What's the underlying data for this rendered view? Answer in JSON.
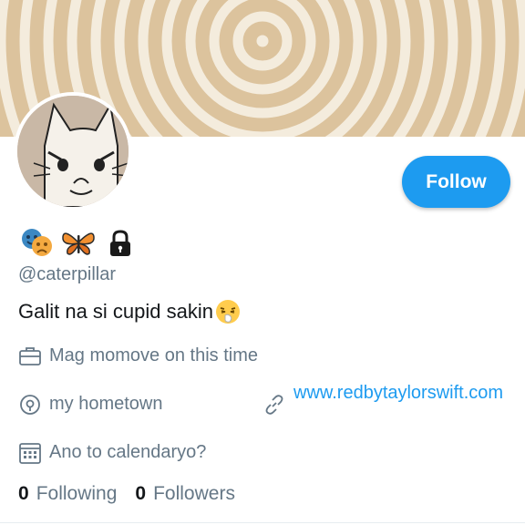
{
  "profile": {
    "handle": "@caterpillar",
    "bio": "Galit na si cupid sakin",
    "follow_label": "Follow",
    "badge_icons": [
      "performing-arts-icon",
      "butterfly-icon",
      "lock-icon"
    ],
    "bio_emoji": "sneezing-face-icon"
  },
  "meta": {
    "work": "Mag momove on this time",
    "location": "my hometown",
    "website": "www.redbytaylorswift.com",
    "joined": "Ano to calendaryo?"
  },
  "stats": {
    "following_count": "0",
    "following_label": "Following",
    "followers_count": "0",
    "followers_label": "Followers"
  },
  "colors": {
    "accent": "#1d9bf0",
    "muted_text": "#657786",
    "banner_swirl": "#dcc39d"
  }
}
